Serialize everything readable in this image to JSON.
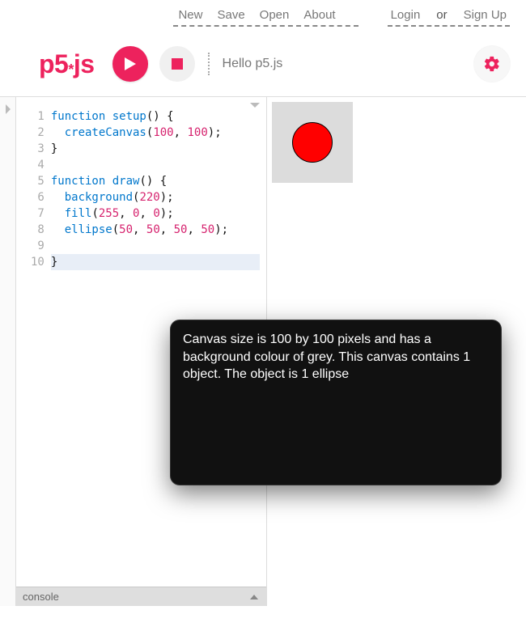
{
  "nav": {
    "new": "New",
    "save": "Save",
    "open": "Open",
    "about": "About",
    "login": "Login",
    "or": "or",
    "signup": "Sign Up"
  },
  "logo": "p5.js",
  "sketch_name": "Hello p5.js",
  "code": {
    "line_numbers": [
      "1",
      "2",
      "3",
      "4",
      "5",
      "6",
      "7",
      "8",
      "9",
      "10"
    ],
    "lines": [
      {
        "segments": [
          {
            "t": "function ",
            "c": "kw"
          },
          {
            "t": "setup",
            "c": "fn"
          },
          {
            "t": "() {",
            "c": "plain"
          }
        ]
      },
      {
        "segments": [
          {
            "t": "  ",
            "c": "plain"
          },
          {
            "t": "createCanvas",
            "c": "fn2"
          },
          {
            "t": "(",
            "c": "plain"
          },
          {
            "t": "100",
            "c": "num"
          },
          {
            "t": ", ",
            "c": "plain"
          },
          {
            "t": "100",
            "c": "num"
          },
          {
            "t": ");",
            "c": "plain"
          }
        ]
      },
      {
        "segments": [
          {
            "t": "}",
            "c": "plain"
          }
        ]
      },
      {
        "segments": [
          {
            "t": "",
            "c": "plain"
          }
        ]
      },
      {
        "segments": [
          {
            "t": "function ",
            "c": "kw"
          },
          {
            "t": "draw",
            "c": "fn"
          },
          {
            "t": "() {",
            "c": "plain"
          }
        ]
      },
      {
        "segments": [
          {
            "t": "  ",
            "c": "plain"
          },
          {
            "t": "background",
            "c": "fn2"
          },
          {
            "t": "(",
            "c": "plain"
          },
          {
            "t": "220",
            "c": "num"
          },
          {
            "t": ");",
            "c": "plain"
          }
        ]
      },
      {
        "segments": [
          {
            "t": "  ",
            "c": "plain"
          },
          {
            "t": "fill",
            "c": "fn2"
          },
          {
            "t": "(",
            "c": "plain"
          },
          {
            "t": "255",
            "c": "num"
          },
          {
            "t": ", ",
            "c": "plain"
          },
          {
            "t": "0",
            "c": "num"
          },
          {
            "t": ", ",
            "c": "plain"
          },
          {
            "t": "0",
            "c": "num"
          },
          {
            "t": ");",
            "c": "plain"
          }
        ]
      },
      {
        "segments": [
          {
            "t": "  ",
            "c": "plain"
          },
          {
            "t": "ellipse",
            "c": "fn2"
          },
          {
            "t": "(",
            "c": "plain"
          },
          {
            "t": "50",
            "c": "num"
          },
          {
            "t": ", ",
            "c": "plain"
          },
          {
            "t": "50",
            "c": "num"
          },
          {
            "t": ", ",
            "c": "plain"
          },
          {
            "t": "50",
            "c": "num"
          },
          {
            "t": ", ",
            "c": "plain"
          },
          {
            "t": "50",
            "c": "num"
          },
          {
            "t": ");",
            "c": "plain"
          }
        ]
      },
      {
        "segments": [
          {
            "t": "",
            "c": "plain"
          }
        ]
      },
      {
        "segments": [
          {
            "t": "}",
            "c": "plain"
          }
        ],
        "highlight": true
      }
    ]
  },
  "console_label": "console",
  "tooltip_text": "Canvas size is 100 by 100 pixels and has a background colour of grey. This canvas contains 1 object. The object is 1 ellipse",
  "canvas": {
    "width": 100,
    "height": 100,
    "bg": "#dcdcdc",
    "circle_fill": "#ff0000"
  }
}
